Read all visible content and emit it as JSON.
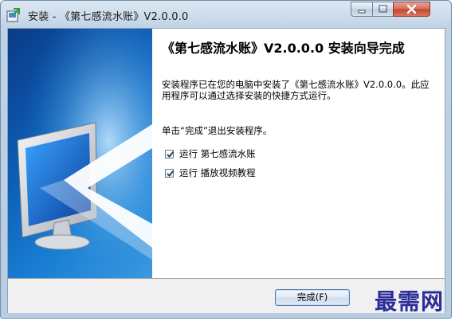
{
  "window": {
    "title": "安装 - 《第七感流水账》V2.0.0.0",
    "controls": [
      "minimize-icon",
      "maximize-icon",
      "close-icon"
    ]
  },
  "wizard": {
    "heading": "《第七感流水账》V2.0.0.0 安装向导完成",
    "description": "安装程序已在您的电脑中安装了《第七感流水账》V2.0.0.0。此应用程序可以通过选择安装的快捷方式运行。",
    "instruction": "单击“完成”退出安装程序。",
    "checkboxes": [
      {
        "label": "运行 第七感流水账",
        "checked": true
      },
      {
        "label": "运行 播放视频教程",
        "checked": true
      }
    ],
    "finish_button": "完成(F)"
  },
  "watermark": "最需网",
  "colors": {
    "side_panel": "#0c5fb8",
    "close_button": "#c3452e",
    "watermark": "#2d2d9a"
  }
}
